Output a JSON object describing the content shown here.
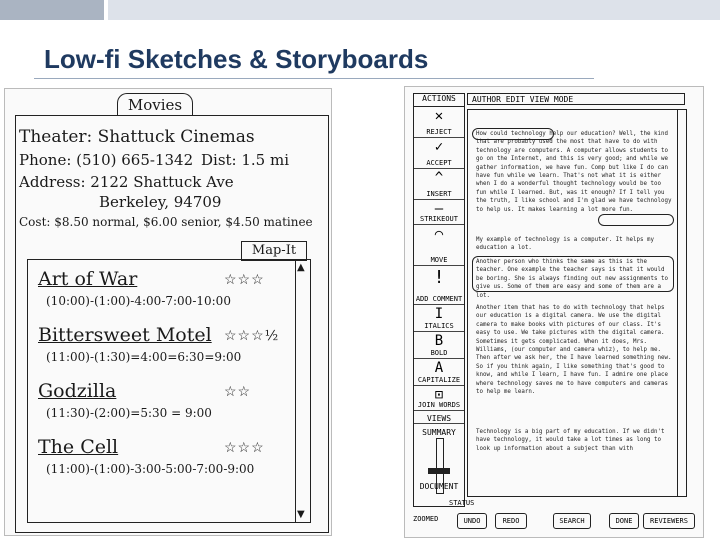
{
  "slide": {
    "title": "Low-fi Sketches & Storyboards",
    "colors": {
      "title": "#1f3a60",
      "topbar_dark": "#aab4c2",
      "topbar_light": "#dde2ea"
    }
  },
  "movie_sketch": {
    "header_tab": "Movies",
    "theater": "Theater: Shattuck Cinemas",
    "phone": "Phone: (510) 665-1342",
    "distance": "Dist: 1.5 mi",
    "address_line1": "Address: 2122 Shattuck Ave",
    "address_line2": "Berkeley, 94709",
    "cost": "Cost: $8.50 normal, $6.00 senior, $4.50 matinee",
    "map_button": "Map-It",
    "scroll_up_icon": "triangle-up",
    "scroll_down_icon": "triangle-down",
    "movies": [
      {
        "title": "Art of War",
        "stars": "☆☆☆",
        "times": "(10:00)-(1:00)-4:00-7:00-10:00"
      },
      {
        "title": "Bittersweet Motel",
        "stars": "☆☆☆½",
        "times": "(11:00)-(1:30)=4:00=6:30=9:00"
      },
      {
        "title": "Godzilla",
        "stars": "☆☆",
        "times": "(11:30)-(2:00)=5:30 = 9:00"
      },
      {
        "title": "The Cell",
        "stars": "☆☆☆",
        "times": "(11:00)-(1:00)-3:00-5:00-7:00-9:00"
      }
    ]
  },
  "editor_sketch": {
    "palette_header": "ACTIONS",
    "menu": "AUTHOR  EDIT  VIEW  MODE",
    "tools": [
      {
        "glyph": "✕",
        "label": "REJECT"
      },
      {
        "glyph": "✓",
        "label": "ACCEPT"
      },
      {
        "glyph": "^",
        "label": "INSERT"
      },
      {
        "glyph": "—",
        "label": "STRIKEOUT"
      },
      {
        "glyph": "⌒",
        "label": "MOVE"
      },
      {
        "glyph": "!",
        "label": "ADD COMMENT"
      },
      {
        "glyph": "I",
        "label": "ITALICS"
      },
      {
        "glyph": "B",
        "label": "BOLD"
      },
      {
        "glyph": "A",
        "label": "CAPITALIZE"
      },
      {
        "glyph": "⊡",
        "label": "JOIN WORDS"
      }
    ],
    "views_label": "VIEWS",
    "summary_label": "SUMMARY",
    "document_label": "DOCUMENT",
    "zoomed_label": "ZOOMED",
    "status_label": "STATUS",
    "paragraphs": [
      "How could technology help our education? Well, the kind that are probably used the most that have to do with technology are computers. A computer allows students to go on the Internet, and this is very good; and while we gather information, we have fun. Comp but like I do can have fun while we learn. That's not what it is either when I do a wonderful thought technology would be too fun while I learned. But, was it enough? If I tell you the truth, I like school and I'm glad we have technology to help us. It makes learning a lot more fun.",
      "My example of technology is a computer. It helps my education a lot.",
      "Another person who thinks the same as this is the teacher. One example the teacher says is that it would be boring. She is always finding out new assignments to give us. Some of them are easy and some of them are a lot.",
      "Another item that has to do with technology that helps our education is a digital camera. We use the digital camera to make books with pictures of our class. It's easy to use. We take pictures with the digital camera. Sometimes it gets complicated. When it does, Mrs. Williams, (our computer and camera whiz), to help me. Then after we ask her, the I have learned something new. So if you think again, I like something that's good to know, and while I learn, I have fun. I admire one place where technology saves me to have computers and cameras to help me learn.",
      "Technology is a big part of my education. If we didn't have technology, it would take a lot times as long to look up information about a subject than with"
    ],
    "buttons": [
      "UNDO",
      "REDO",
      "SEARCH",
      "DONE",
      "REVIEWERS"
    ]
  }
}
